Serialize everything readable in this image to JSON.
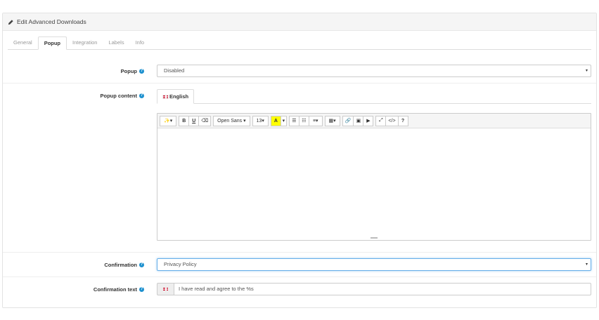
{
  "panel": {
    "title": "Edit Advanced Downloads"
  },
  "tabs": [
    {
      "label": "General",
      "active": false
    },
    {
      "label": "Popup",
      "active": true
    },
    {
      "label": "Integration",
      "active": false
    },
    {
      "label": "Labels",
      "active": false
    },
    {
      "label": "Info",
      "active": false
    }
  ],
  "fields": {
    "popup": {
      "label": "Popup",
      "value": "Disabled"
    },
    "popup_content": {
      "label": "Popup content",
      "language_tab": "English"
    },
    "confirmation": {
      "label": "Confirmation",
      "value": "Privacy Policy"
    },
    "confirmation_text": {
      "label": "Confirmation text",
      "value": "I have read and agree to the %s"
    }
  },
  "editor_toolbar": {
    "style": "✨▾",
    "bold": "B",
    "underline": "U",
    "clear": "⌫",
    "font_name": "Open Sans ▾",
    "font_size": "13▾",
    "color": "A",
    "color_caret": "▾",
    "ul": "☰",
    "ol": "☷",
    "paragraph": "≡▾",
    "table": "▦▾",
    "link": "🔗",
    "picture": "▣",
    "video": "▶",
    "fullscreen": "⤢",
    "codeview": "</>",
    "help": "?"
  },
  "help_icon": "?",
  "caret": "▾",
  "colors": {
    "accent": "#1e91cf",
    "focus_border": "#66afe9",
    "highlight": "#ffff00"
  }
}
